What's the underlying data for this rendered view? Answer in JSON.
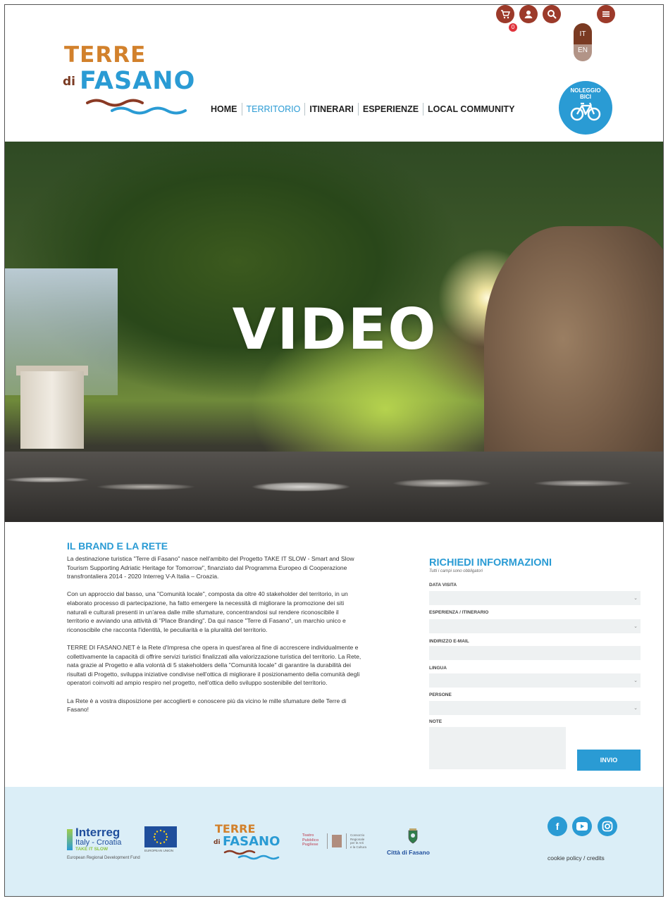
{
  "header": {
    "logo": {
      "line1": "TERRE",
      "line2a": "di",
      "line2b": "FASANO"
    },
    "cart_count": "0",
    "lang": {
      "it": "IT",
      "en": "EN"
    },
    "nav": [
      {
        "label": "HOME"
      },
      {
        "label": "TERRITORIO"
      },
      {
        "label": "ITINERARI"
      },
      {
        "label": "ESPERIENZE"
      },
      {
        "label": "LOCAL COMMUNITY"
      }
    ],
    "bike_label_1": "NOLEGGIO",
    "bike_label_2": "BICI",
    "icons": {
      "cart": "cart-icon",
      "user": "user-icon",
      "search": "search-icon",
      "menu": "menu-icon",
      "bike": "bicycle-icon"
    },
    "accent_color": "#2a9bd4",
    "brand_brown": "#9c3a2a"
  },
  "hero": {
    "title": "VIDEO"
  },
  "brand": {
    "title": "IL BRAND E LA RETE",
    "paragraphs": [
      "La destinazione turistica \"Terre di Fasano\" nasce nell'ambito del Progetto TAKE IT SLOW - Smart and Slow Tourism Supporting Adriatic Heritage for Tomorrow\", finanziato dal Programma Europeo di Cooperazione transfrontaliera 2014 - 2020 Interreg V-A Italia – Croazia.",
      "Con un approccio dal basso, una \"Comunità locale\", composta da oltre 40 stakeholder del territorio, in un elaborato processo di partecipazione, ha fatto emergere la necessità di migliorare la promozione dei siti naturali e culturali presenti in un'area dalle mille sfumature, concentrandosi sul rendere riconoscibile il territorio e avviando una attività di \"Place Branding\". Da qui nasce \"Terre di Fasano\", un marchio unico e riconoscibile che racconta l'identità, le peculiarità e la pluralità del territorio.",
      "TERRE DI FASANO.NET è la Rete d'Impresa che opera in quest'area al fine di accrescere individualmente e collettivamente la capacità di offrire servizi turistici finalizzati alla valorizzazione turistica del territorio. La Rete, nata grazie al Progetto e alla volontà di 5 stakeholders della \"Comunità locale\" di garantire la durabilità dei risultati di Progetto, sviluppa iniziative condivise nell'ottica di migliorare il posizionamento della comunità degli operatori coinvolti ad ampio respiro nel progetto, nell'ottica dello sviluppo sostenibile del territorio.",
      "La Rete è a vostra disposizione per accoglierti e conoscere più da vicino le mille sfumature delle Terre di Fasano!"
    ]
  },
  "form": {
    "title": "RICHIEDI INFORMAZIONI",
    "subtitle": "Tutti i campi sono obbligatori",
    "fields": [
      {
        "label": "DATA VISITA",
        "type": "select"
      },
      {
        "label": "ESPERIENZA / ITINERARIO",
        "type": "select"
      },
      {
        "label": "INDIRIZZO E-MAIL",
        "type": "text"
      },
      {
        "label": "LINGUA",
        "type": "select"
      },
      {
        "label": "PERSONE",
        "type": "select"
      }
    ],
    "notes_label": "NOTE",
    "submit_label": "INVIO"
  },
  "footer": {
    "interreg": {
      "name": "Interreg",
      "program": "Italy - Croatia",
      "project": "TAKE IT SLOW",
      "fund": "European Regional Development Fund",
      "eu_note": "EUROPEAN UNION"
    },
    "logo": {
      "line1": "TERRE",
      "line2a": "di",
      "line2b": "FASANO"
    },
    "partner": {
      "line1": "Teatro",
      "line2": "Pubblico",
      "line3": "Pugliese",
      "line4": "Consorzio",
      "line5": "Regionale",
      "line6": "per le Arti",
      "line7": "e la Cultura"
    },
    "city": "Città di Fasano",
    "cookie": "cookie policy / credits",
    "social": [
      "facebook-icon",
      "youtube-icon",
      "instagram-icon"
    ]
  }
}
